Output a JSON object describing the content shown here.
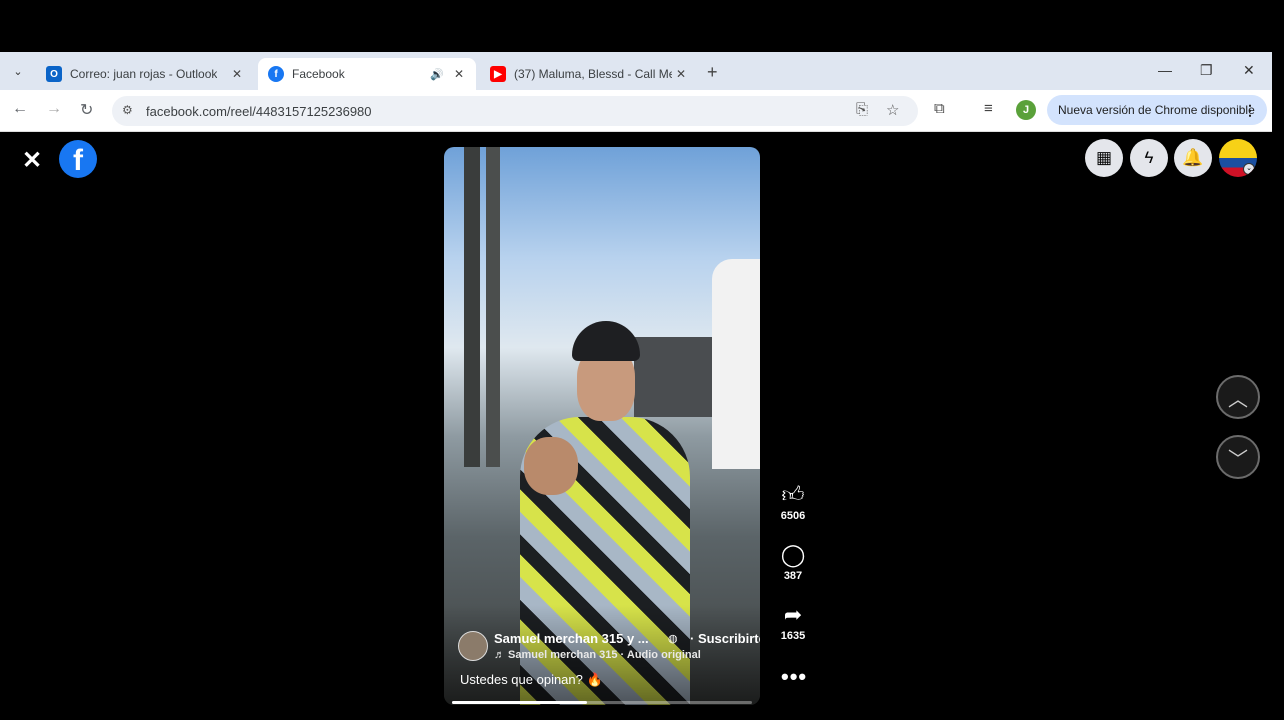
{
  "browser": {
    "tabs": [
      {
        "title": "Correo: juan rojas - Outlook",
        "icon": "outlook-icon"
      },
      {
        "title": "Facebook",
        "icon": "facebook-icon",
        "active": true
      },
      {
        "title": "(37) Maluma, Blessd - Call Me (",
        "icon": "youtube-icon"
      }
    ],
    "url": "facebook.com/reel/4483157125236980",
    "update_label": "Nueva versión de Chrome disponible",
    "profile_initial": "J",
    "colors": {
      "tabstrip": "#dfe6f1",
      "update_pill": "#d3e3fd",
      "facebook_blue": "#1877f2"
    }
  },
  "reel": {
    "author": "Samuel merchan 315 y ...",
    "subscribe_label": "· Suscribirte",
    "audio": "♬ Samuel merchan 315 · Audio original",
    "caption": "Ustedes que opinan?",
    "progress_percent": 45,
    "likes": "6506",
    "comments": "387",
    "shares": "1635"
  }
}
